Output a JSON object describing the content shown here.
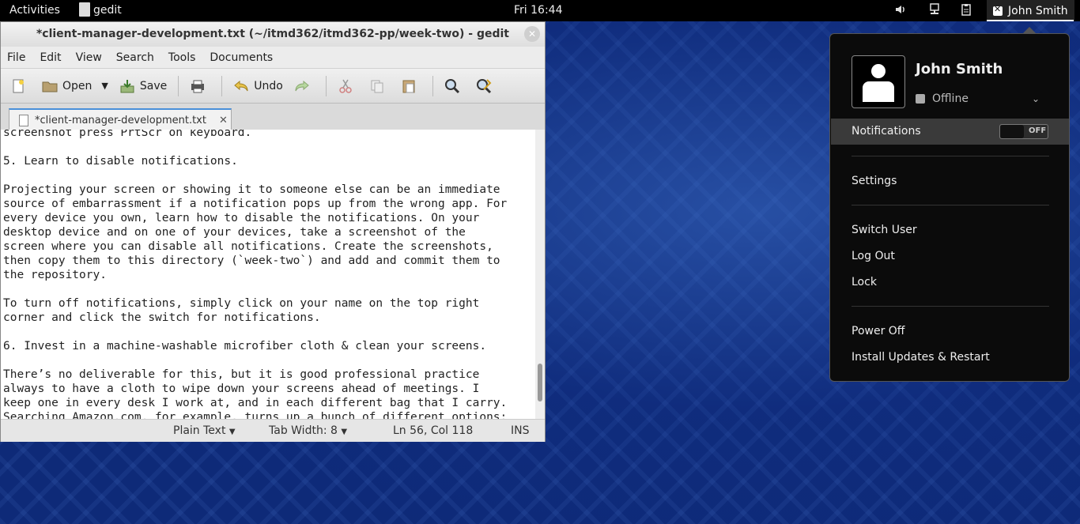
{
  "topbar": {
    "activities": "Activities",
    "app_name": "gedit",
    "clock": "Fri 16:44",
    "user_name": "John Smith"
  },
  "window": {
    "title": "*client-manager-development.txt (~/itmd362/itmd362-pp/week-two) - gedit",
    "menus": [
      "File",
      "Edit",
      "View",
      "Search",
      "Tools",
      "Documents"
    ],
    "toolbar": {
      "open": "Open",
      "save": "Save",
      "undo": "Undo"
    },
    "tab_label": "*client-manager-development.txt",
    "editor_lines": [
      "screenshot press PrtScr on keyboard.",
      "",
      "5. Learn to disable notifications.",
      "",
      "Projecting your screen or showing it to someone else can be an immediate",
      "source of embarrassment if a notification pops up from the wrong app. For",
      "every device you own, learn how to disable the notifications. On your",
      "desktop device and on one of your devices, take a screenshot of the",
      "screen where you can disable all notifications. Create the screenshots,",
      "then copy them to this directory (`week-two`) and add and commit them to",
      "the repository.",
      "",
      "To turn off notifications, simply click on your name on the top right",
      "corner and click the switch for notifications.",
      "",
      "6. Invest in a machine-washable microfiber cloth & clean your screens.",
      "",
      "There’s no deliverable for this, but it is good professional practice",
      "always to have a cloth to wipe down your screens ahead of meetings. I",
      "keep one in every desk I work at, and in each different bag that I carry.",
      "Searching Amazon.com, for example, turns up a bunch of different options:"
    ],
    "status": {
      "syntax": "Plain Text",
      "tab_width": "Tab Width:  8",
      "position": "Ln 56, Col 118",
      "mode": "INS"
    }
  },
  "user_menu": {
    "name": "John Smith",
    "presence": "Offline",
    "notifications_label": "Notifications",
    "notifications_state": "OFF",
    "items": {
      "settings": "Settings",
      "switch_user": "Switch User",
      "log_out": "Log Out",
      "lock": "Lock",
      "power_off": "Power Off",
      "install_updates": "Install Updates & Restart"
    }
  }
}
